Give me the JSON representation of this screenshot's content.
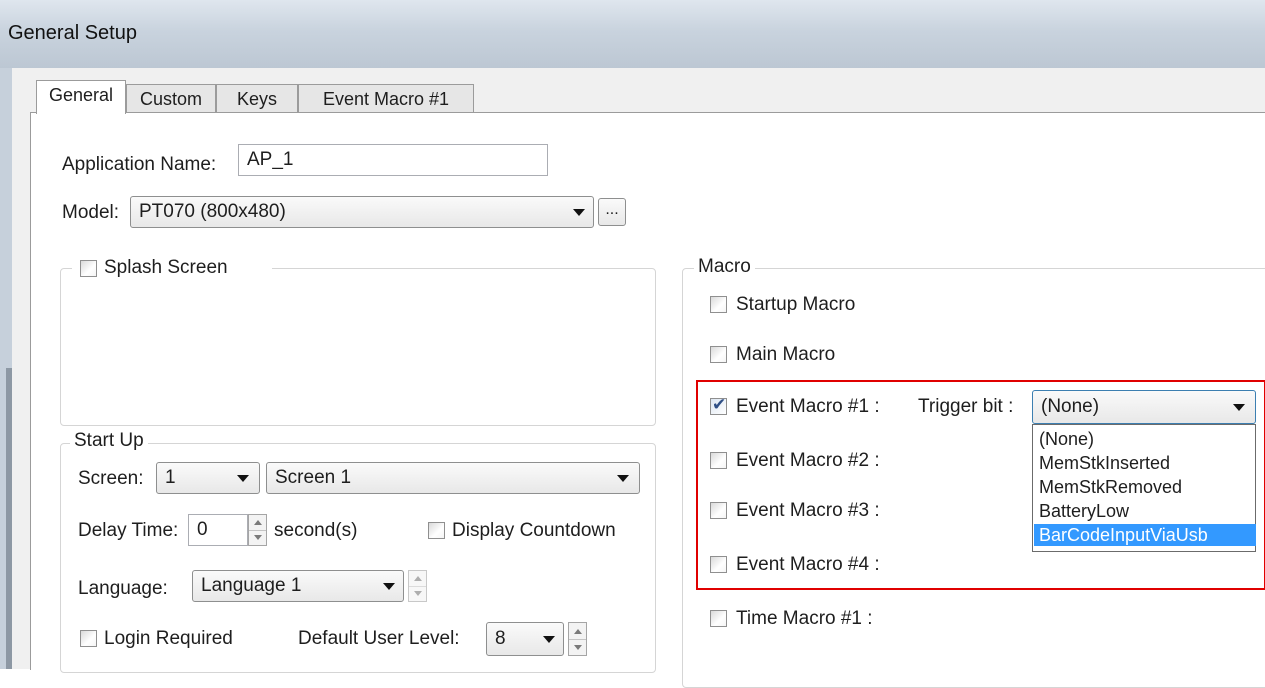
{
  "window": {
    "title": "General Setup"
  },
  "tabs": [
    {
      "label": "General",
      "active": true
    },
    {
      "label": "Custom"
    },
    {
      "label": "Keys"
    },
    {
      "label": "Event Macro #1"
    }
  ],
  "general": {
    "app_name_label": "Application Name:",
    "app_name_value": "AP_1",
    "model_label": "Model:",
    "model_value": "PT070 (800x480)",
    "browse_label": "..."
  },
  "splash": {
    "label": "Splash Screen",
    "checked": false
  },
  "startup": {
    "legend": "Start Up",
    "screen_label": "Screen:",
    "screen_num": "1",
    "screen_name": "Screen 1",
    "delay_label": "Delay Time:",
    "delay_value": "0",
    "delay_unit": "second(s)",
    "countdown_label": "Display Countdown",
    "language_label": "Language:",
    "language_value": "Language 1",
    "login_label": "Login Required",
    "user_level_label": "Default User Level:",
    "user_level_value": "8"
  },
  "macro": {
    "legend": "Macro",
    "startup_label": "Startup Macro",
    "main_label": "Main Macro",
    "event1_label": "Event Macro #1 :",
    "event1_checked": true,
    "trigger_label": "Trigger bit :",
    "trigger_value": "(None)",
    "event2_label": "Event Macro #2 :",
    "event3_label": "Event Macro #3 :",
    "event4_label": "Event Macro #4 :",
    "time1_label": "Time Macro #1 :"
  },
  "trigger_options": [
    "(None)",
    "MemStkInserted",
    "MemStkRemoved",
    "BatteryLow",
    "BarCodeInputViaUsb"
  ],
  "trigger_selected_index": 4,
  "colors": {
    "highlight_border": "#e00000",
    "selection": "#3399ff",
    "check_mark": "#2f4f86"
  }
}
